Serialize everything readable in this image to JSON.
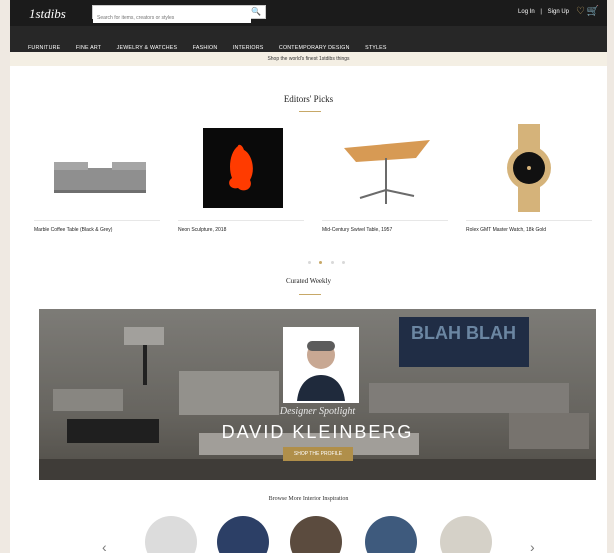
{
  "header": {
    "logo": "1stdibs",
    "search_placeholder": "Search for items, creators or styles",
    "account": {
      "login": "Log In",
      "separator": "|",
      "signup": "Sign Up"
    }
  },
  "nav": {
    "items": [
      "FURNITURE",
      "FINE ART",
      "JEWELRY & WATCHES",
      "FASHION",
      "INTERIORS",
      "CONTEMPORARY DESIGN",
      "STYLES"
    ]
  },
  "promo": {
    "text": "Shop the world's finest 1stdibs things"
  },
  "editors": {
    "title": "Editors' Picks",
    "products": [
      {
        "caption": "Marble Coffee Table (Black & Grey)"
      },
      {
        "caption": "Neon Sculpture, 2018"
      },
      {
        "caption": "Mid-Century Swivel Table, 1957"
      },
      {
        "caption": "Rolex GMT Master Watch, 18k Gold"
      }
    ],
    "carousel": {
      "count": 4,
      "active": 1
    }
  },
  "curated": {
    "title": "Curated Weekly",
    "banner": {
      "subtitle": "Designer Spotlight",
      "designer": "DAVID KLEINBERG",
      "cta": "SHOP THE PROFILE"
    }
  },
  "inspiration": {
    "title": "Browse More Interior Inspiration"
  },
  "colors": {
    "accent": "#c7a867",
    "header_bg": "#1b1b1b",
    "nav_bg": "#272727",
    "promo_bg": "#f4efe4",
    "cta_bg": "#b08f4a"
  },
  "icons": [
    "search-icon",
    "heart-icon",
    "cart-icon",
    "chevron-left-icon",
    "chevron-right-icon"
  ]
}
